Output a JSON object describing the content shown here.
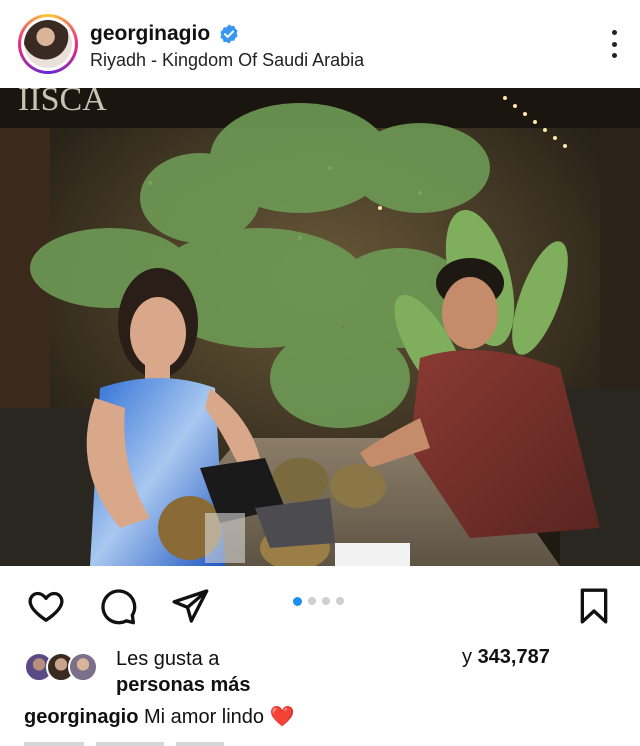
{
  "post": {
    "username": "georginagio",
    "verified": true,
    "location": "Riyadh - Kingdom Of Saudi Arabia",
    "carousel": {
      "total": 4,
      "current": 1
    },
    "likes": {
      "label_line1": "Les gusta a",
      "label_line2": "personas más",
      "count_prefix": "y",
      "count": "343,787"
    },
    "caption": {
      "username": "georginagio",
      "text": "Mi amor lindo",
      "emoji": "❤️"
    }
  },
  "icons": {
    "more": "more-vertical-icon",
    "like": "heart-icon",
    "comment": "comment-icon",
    "share": "send-icon",
    "save": "bookmark-icon",
    "verified": "verified-badge-icon"
  },
  "colors": {
    "verified_blue": "#3897f0",
    "carousel_active": "#1f8ef1",
    "heart_red": "#e11d2b"
  }
}
